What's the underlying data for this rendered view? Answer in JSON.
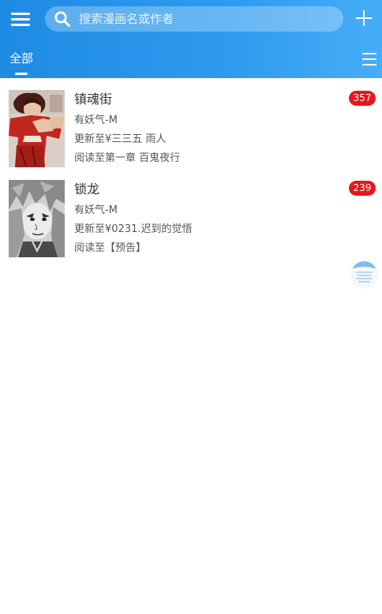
{
  "header": {
    "search_placeholder": "搜索漫画名或作者",
    "tab_all": "全部"
  },
  "comics": [
    {
      "title": "镇魂街",
      "author": "有妖气-M",
      "update": "更新至¥三三五 雨人",
      "progress": "阅读至第一章 百鬼夜行",
      "badge": "357"
    },
    {
      "title": "锁龙",
      "author": "有妖气-M",
      "update": "更新至¥0231.迟到的觉悟",
      "progress": "阅读至【预告】",
      "badge": "239"
    }
  ],
  "colors": {
    "header_start": "#1e8be3",
    "header_end": "#47adf6",
    "badge": "#e8161b"
  },
  "icons": [
    "menu-icon",
    "search-icon",
    "add-icon",
    "list-icon"
  ]
}
